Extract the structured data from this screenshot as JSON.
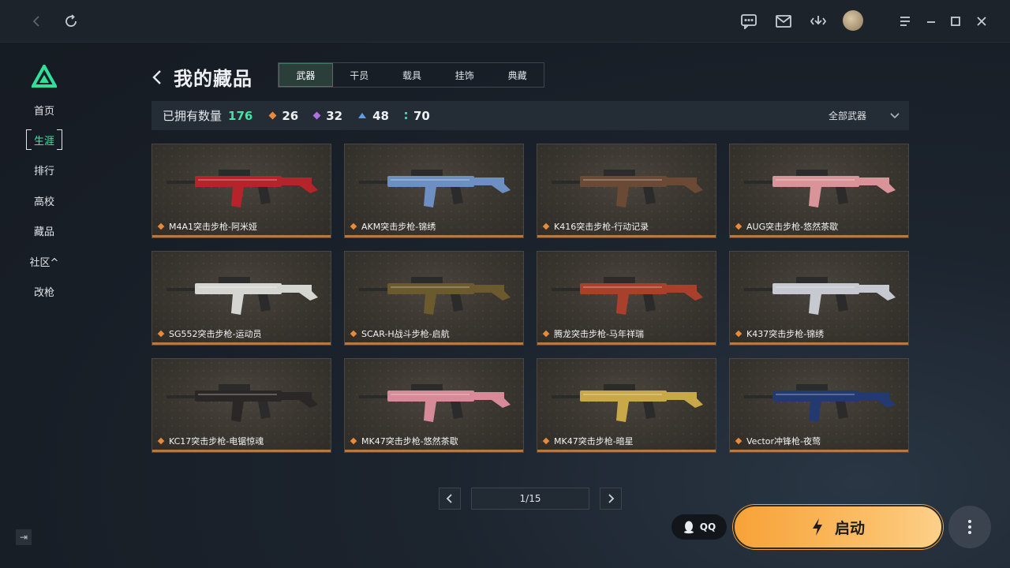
{
  "topbar": {
    "icons": [
      "back-icon",
      "refresh-icon",
      "chat-icon",
      "mail-icon",
      "download-icon",
      "avatar",
      "menu-icon",
      "minimize-icon",
      "maximize-icon",
      "close-icon"
    ]
  },
  "sidebar": {
    "items": [
      {
        "label": "首页"
      },
      {
        "label": "生涯"
      },
      {
        "label": "排行"
      },
      {
        "label": "高校"
      },
      {
        "label": "藏品"
      },
      {
        "label": "社区^"
      },
      {
        "label": "改枪"
      }
    ],
    "active_index": 1
  },
  "header": {
    "title": "我的藏品",
    "tabs": [
      "武器",
      "干员",
      "载具",
      "挂饰",
      "典藏"
    ],
    "active_tab": 0
  },
  "stats": {
    "owned_label": "已拥有数量",
    "owned_total": "176",
    "rarities": [
      {
        "count": "26",
        "color": "#e98a3a"
      },
      {
        "count": "32",
        "color": "#b070e0"
      },
      {
        "count": "48",
        "color": "#5aa0e8"
      },
      {
        "count": "70",
        "color": "#3fc8b0"
      }
    ],
    "filter_label": "全部武器"
  },
  "items": [
    {
      "name": "M4A1突击步枪-阿米娅",
      "color": "#b4242a"
    },
    {
      "name": "AKM突击步枪-锦绣",
      "color": "#6d8fc2"
    },
    {
      "name": "K416突击步枪-行动记录",
      "color": "#6a4a34"
    },
    {
      "name": "AUG突击步枪-悠然茶歇",
      "color": "#d9949a"
    },
    {
      "name": "SG552突击步枪-运动员",
      "color": "#d5d5d2"
    },
    {
      "name": "SCAR-H战斗步枪-启航",
      "color": "#6b5a2e"
    },
    {
      "name": "腾龙突击步枪-马年祥瑞",
      "color": "#a8402c"
    },
    {
      "name": "K437突击步枪-锦绣",
      "color": "#c6c9cf"
    },
    {
      "name": "KC17突击步枪-电锯惊魂",
      "color": "#2a2726"
    },
    {
      "name": "MK47突击步枪-悠然茶歇",
      "color": "#d78a97"
    },
    {
      "name": "MK47突击步枪-暗星",
      "color": "#c9a84a"
    },
    {
      "name": "Vector冲锋枪-夜莺",
      "color": "#223a70"
    }
  ],
  "pagination": {
    "page_text": "1/15"
  },
  "footer": {
    "qq_label": "QQ",
    "launch_label": "启动"
  }
}
